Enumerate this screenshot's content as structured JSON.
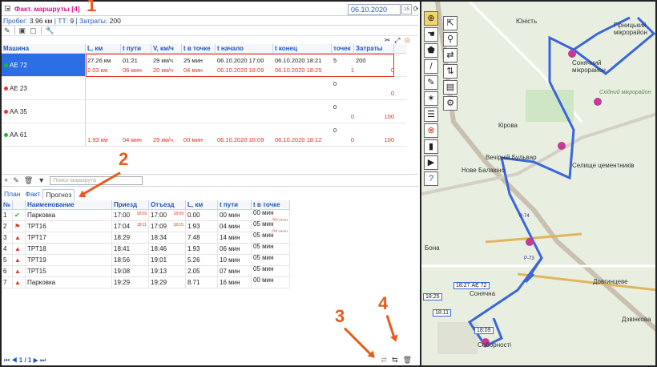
{
  "header": {
    "title": "Факт. маршруты [4]",
    "date": "06.10.2020"
  },
  "stats": {
    "prefix1": "Пробег: ",
    "mileage": "3.96 км",
    "sep1": " | ТТ: ",
    "tt": "9",
    "sep2": " | Затраты: ",
    "costs": "200"
  },
  "table": {
    "columns": [
      "Машина",
      "L, км",
      "t пути",
      "V, км/ч",
      "t в точке",
      "t начало",
      "t конец",
      "точек",
      "Затраты"
    ],
    "rows": [
      {
        "machine": "АЕ 72",
        "dot": "#20b82a",
        "line1": [
          "27.26 км",
          "01:21",
          "29 км/ч",
          "25 мин",
          "06.10.2020 17:00",
          "06.10.2020 18:21",
          "5",
          "200"
        ],
        "line2": [
          "2.03 км",
          "06 мин",
          "20 км/ч",
          "04 мин",
          "06.10.2020 18:09",
          "06.10.2020 18:25",
          "1",
          "0"
        ]
      },
      {
        "machine": "АЕ 23",
        "dot": "#e33",
        "line1": [
          "",
          "",
          "",
          "",
          "",
          "",
          "0",
          ""
        ],
        "line2": [
          "",
          "",
          "",
          "",
          "",
          "",
          "",
          "0"
        ]
      },
      {
        "machine": "АА 35",
        "dot": "#e33",
        "line1": [
          "",
          "",
          "",
          "",
          "",
          "",
          "0",
          ""
        ],
        "line2": [
          "",
          "",
          "",
          "",
          "",
          "",
          "0",
          "100"
        ]
      },
      {
        "machine": "АА 61",
        "dot": "#20b82a",
        "line1": [
          "",
          "",
          "",
          "",
          "",
          "",
          "0",
          ""
        ],
        "line2": [
          "1.93 км",
          "04 мин",
          "29 км/ч",
          "00 мин",
          "06.10.2020 18:09",
          "06.10.2020 18:12",
          "0",
          "100"
        ]
      }
    ]
  },
  "search": {
    "placeholder": "Поиск маршрута"
  },
  "tabs": [
    "План",
    "Факт",
    "Прогноз"
  ],
  "bottom": {
    "columns": [
      "№",
      "Наименование",
      "Приезд",
      "Отъезд",
      "L, км",
      "t пути",
      "t в точке"
    ],
    "rows": [
      {
        "n": "1",
        "status": "check",
        "name": "Парковка",
        "arr": "17:00",
        "arrr": "18:09",
        "dep": "17:00",
        "depr": "18:09",
        "l": "0.00",
        "t": "00 мин",
        "tp": "00 мин",
        "tp2": "00 мин"
      },
      {
        "n": "2",
        "status": "map",
        "name": "ТРТ16",
        "arr": "17:04",
        "arrr": "18:11",
        "dep": "17:09",
        "depr": "18:15",
        "l": "1.93",
        "t": "04 мин",
        "tp": "05 мин",
        "tp2": "04 мин"
      },
      {
        "n": "3",
        "status": "warn",
        "name": "ТРТ17",
        "arr": "18:29",
        "arrr": "",
        "dep": "18:34",
        "depr": "",
        "l": "7.48",
        "t": "14 мин",
        "tp": "05 мин",
        "tp2": ""
      },
      {
        "n": "4",
        "status": "warn",
        "name": "ТРТ18",
        "arr": "18:41",
        "arrr": "",
        "dep": "18:46",
        "depr": "",
        "l": "1.93",
        "t": "06 мин",
        "tp": "05 мин",
        "tp2": ""
      },
      {
        "n": "5",
        "status": "warn",
        "name": "ТРТ19",
        "arr": "18:56",
        "arrr": "",
        "dep": "19:01",
        "depr": "",
        "l": "5.26",
        "t": "10 мин",
        "tp": "05 мин",
        "tp2": ""
      },
      {
        "n": "6",
        "status": "warn",
        "name": "ТРТ15",
        "arr": "19:08",
        "arrr": "",
        "dep": "19:13",
        "depr": "",
        "l": "2.05",
        "t": "07 мин",
        "tp": "05 мин",
        "tp2": ""
      },
      {
        "n": "7",
        "status": "warn",
        "name": "Парковка",
        "arr": "19:29",
        "arrr": "",
        "dep": "19:29",
        "depr": "",
        "l": "8.71",
        "t": "16 мин",
        "tp": "00 мин",
        "tp2": ""
      }
    ]
  },
  "pager": "1 / 1",
  "annotations": [
    "1",
    "2",
    "3",
    "4"
  ],
  "map": {
    "labels": [
      "Юність",
      "Гірницький мікрорайон",
      "Сонячний мікрорайон",
      "Східний мікрорайон",
      "Кірова",
      "Вечірній Бульвар",
      "Нове Балакіно",
      "Селище цементників",
      "Бона",
      "Довгинцеве",
      "Дзвінкова",
      "Сонячна",
      "Соборності",
      "Р-74",
      "Р-73"
    ],
    "markers": [
      "18:27 АЕ 72",
      "18:25",
      "18:11",
      "18:09"
    ]
  }
}
